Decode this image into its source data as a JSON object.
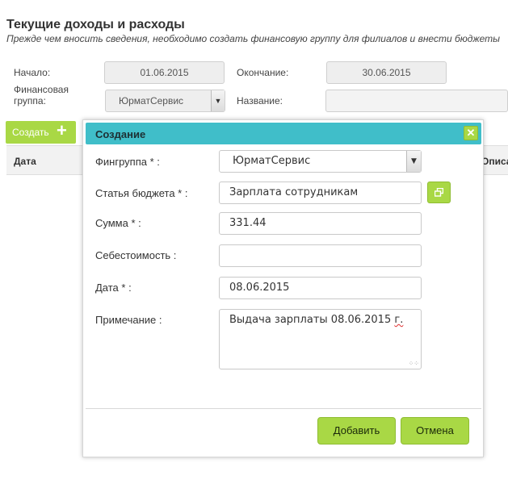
{
  "page": {
    "title": "Текущие доходы и расходы",
    "subtitle": "Прежде чем вносить сведения, необходимо создать финансовую группу для филиалов и внести бюджеты"
  },
  "filters": {
    "start_label": "Начало:",
    "start_value": "01.06.2015",
    "end_label": "Окончание:",
    "end_value": "30.06.2015",
    "group_label": "Финансовая группа:",
    "group_value": "ЮрматСервис",
    "name_label": "Название:",
    "name_value": ""
  },
  "toolbar": {
    "create_label": "Создать",
    "create_icon": "plus-icon"
  },
  "table": {
    "columns": [
      "Дата",
      "Описание"
    ]
  },
  "modal": {
    "title": "Создание",
    "close_icon": "close-icon",
    "fields": {
      "fingroup_label": "Фингруппа * :",
      "fingroup_value": "ЮрматСервис",
      "budget_label": "Статья бюджета * :",
      "budget_value": "Зарплата сотрудникам",
      "budget_picker_icon": "open-window-icon",
      "amount_label": "Сумма * :",
      "amount_value": "331.44",
      "cost_label": "Себестоимость :",
      "cost_value": "",
      "date_label": "Дата * :",
      "date_value": "08.06.2015",
      "note_label": "Примечание :",
      "note_text": "Выдача зарплаты 08.06.2015",
      "note_suffix": "г."
    },
    "add_label": "Добавить",
    "cancel_label": "Отмена"
  },
  "colors": {
    "accent_green": "#a9d845",
    "header_teal": "#40bec9"
  }
}
